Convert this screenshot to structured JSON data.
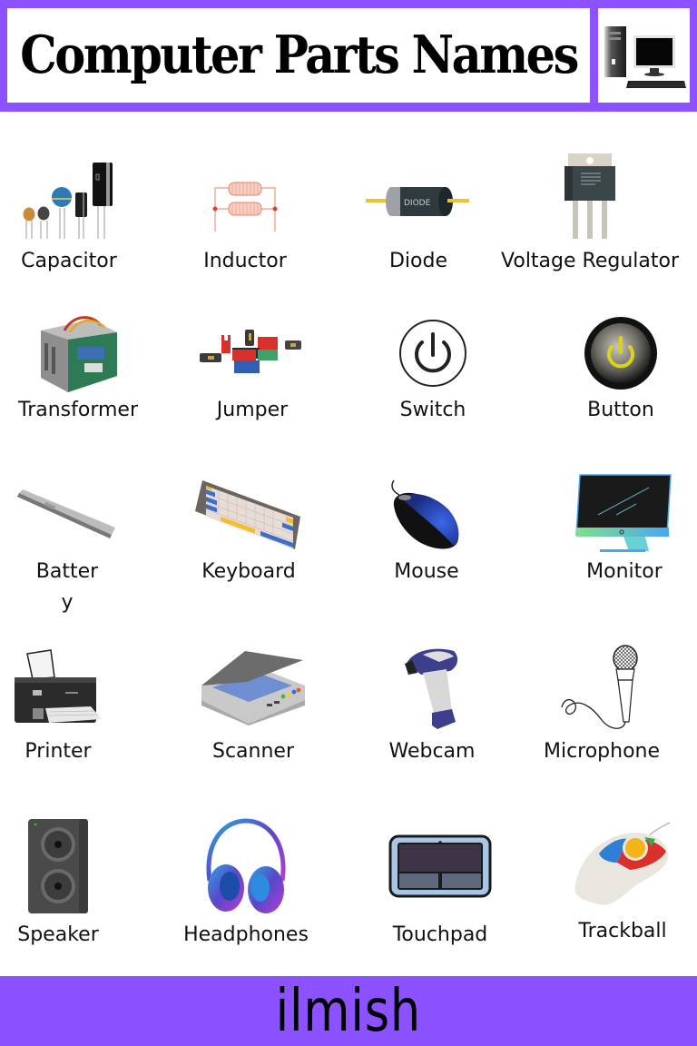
{
  "header": {
    "title": "Computer Parts Names",
    "logo_icon": "desktop-computer-icon"
  },
  "items": [
    {
      "label": "Capacitor",
      "icon": "capacitor-icon"
    },
    {
      "label": "Inductor",
      "icon": "inductor-icon"
    },
    {
      "label": "Diode",
      "icon": "diode-icon",
      "icon_text": "DIODE"
    },
    {
      "label": "Voltage Regulator",
      "icon": "voltage-regulator-icon"
    },
    {
      "label": "Transformer",
      "icon": "transformer-icon"
    },
    {
      "label": "Jumper",
      "icon": "jumper-icon"
    },
    {
      "label": "Switch",
      "icon": "power-switch-icon"
    },
    {
      "label": "Button",
      "icon": "power-button-icon"
    },
    {
      "label": "Battery",
      "icon": "battery-icon"
    },
    {
      "label": "Keyboard",
      "icon": "keyboard-icon"
    },
    {
      "label": "Mouse",
      "icon": "mouse-icon"
    },
    {
      "label": "Monitor",
      "icon": "monitor-icon"
    },
    {
      "label": "Printer",
      "icon": "printer-icon"
    },
    {
      "label": "Scanner",
      "icon": "scanner-icon"
    },
    {
      "label": "Webcam",
      "icon": "barcode-scanner-icon"
    },
    {
      "label": "Microphone",
      "icon": "microphone-icon"
    },
    {
      "label": "Speaker",
      "icon": "speaker-icon"
    },
    {
      "label": "Headphones",
      "icon": "headphones-icon"
    },
    {
      "label": "Touchpad",
      "icon": "touchpad-icon"
    },
    {
      "label": "Trackball",
      "icon": "trackball-icon"
    }
  ],
  "footer": {
    "brand": "ilmish"
  },
  "colors": {
    "accent_purple": "#8c52ff",
    "text": "#111111",
    "background": "#ffffff"
  }
}
